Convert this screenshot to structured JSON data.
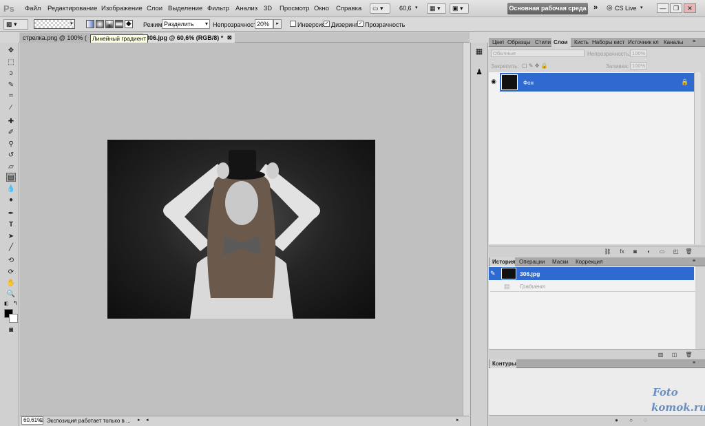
{
  "app": {
    "logo": "Ps",
    "menu": [
      "Файл",
      "Редактирование",
      "Изображение",
      "Слои",
      "Выделение",
      "Фильтр",
      "Анализ",
      "3D",
      "Просмотр",
      "Окно",
      "Справка"
    ],
    "zoom_value": "60,6",
    "workspace_label": "Основная рабочая среда",
    "cslive_label": "CS Live",
    "window_buttons": [
      "—",
      "❐",
      "✕"
    ]
  },
  "options": {
    "mode_label": "Режим:",
    "mode_value": "Разделить",
    "opacity_label": "Непрозрачность:",
    "opacity_value": "20%",
    "checkboxes": [
      {
        "label": "Инверсия",
        "checked": false
      },
      {
        "label": "Дизеринг",
        "checked": true
      },
      {
        "label": "Прозрачность",
        "checked": true
      }
    ]
  },
  "tabs": {
    "tab1": "стрелка.png @ 100% (",
    "tab2": "306.jpg @ 60,6% (RGB/8) *",
    "tooltip": "Линейный градиент"
  },
  "status": {
    "zoom": "60,61%",
    "text": "Экспозиция работает только в ..."
  },
  "layers_panel": {
    "tabs": [
      "Цвет",
      "Образцы",
      "Стили",
      "Слои",
      "Кисть",
      "Наборы кист",
      "Источник кл",
      "Каналы"
    ],
    "active_tab": "Слои",
    "blend_mode": "Обычные",
    "opacity_label": "Непрозрачность:",
    "opacity_value": "100%",
    "lock_label": "Закрепить:",
    "fill_label": "Заливка:",
    "fill_value": "100%",
    "layer_name": "Фон"
  },
  "history_panel": {
    "tabs": [
      "История",
      "Операции",
      "Маски",
      "Коррекция"
    ],
    "active_tab": "История",
    "items": [
      "306.jpg",
      "Градиент"
    ]
  },
  "paths_panel": {
    "tabs": [
      "Контуры"
    ]
  },
  "watermark": {
    "line1": "Foto",
    "line2": "komok.ru"
  },
  "colors": {
    "selection": "#2f6ad1",
    "canvas_bg": "#c0c0c0"
  }
}
